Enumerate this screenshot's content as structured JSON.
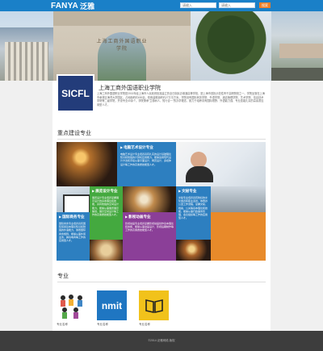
{
  "header": {
    "logo_en": "FANYA",
    "logo_cn": "泛雅",
    "search1_placeholder": "请输入",
    "search2_placeholder": "请输入",
    "search_button": "搜索"
  },
  "banner": {
    "gate_text": "上海工商外国语职业学院"
  },
  "intro": {
    "logo_text": "SICFL",
    "title": "上海工商外国语职业学院",
    "text": "上海工商外国语职业学院是2002年经上海市人民政府批准建立的全日制民办普通高等学校，是上海市首批示范性骨干高职院校之一。学院坐落在上海市奉贤区海湾大学园区，占地面积约630亩，校舍建筑面积约27万平方米。学院设有国际商务学院、外语学院、酒店管理学院、艺术学院、信息技术学院等二级学院，开设专业40余个。学院秉承“立德树人、知行合一”的办学理念，致力于培养具有国际视野、外语能力强、专业技能扎实的高素质应用型人才。"
  },
  "sections": {
    "featured": "重点建设专业",
    "majors": "专业"
  },
  "tiles": [
    {
      "title": "电脑艺术设计专业",
      "text": "电脑艺术设计专业培养具有扎实的设计基础理论知识和较强的计算机应用能力，能够运用现代设计方法和手段从事平面设计、网页设计、多媒体设计等工作的高素质技能型人才。"
    },
    {
      "title": "文秘专业",
      "text": "文秘专业培养具有较好的文化素养和职业道德，熟悉办公室工作流程，掌握文秘、档案、公关等基本理论和技能，能够从事行政事务管理、会议组织等工作的应用型人才。"
    },
    {
      "title": "展览设计专业",
      "text": "展览设计专业培养掌握展示设计的基本理论和技能，具有较强的空间设计能力，能够从事展览展示策划、展示空间设计等工作的高素质技能型人才。"
    },
    {
      "title": "国际商务专业",
      "text": "国际商务专业培养具有国际贸易基本理论知识和较强的外语能力，熟悉国际商务规则，能够从事外贸业务、跨境电商等工作的应用型人才。"
    },
    {
      "title": "影视动画专业",
      "text": "影视动画专业培养掌握影视动画创作基本理论和技能，能够从事动画设计、影视后期制作等工作的高素质技能型人才。"
    }
  ],
  "majors": [
    {
      "label": "专业名称"
    },
    {
      "label": "专业名称"
    },
    {
      "label": "专业名称"
    }
  ],
  "thumbs": {
    "nmit": "nmit"
  },
  "footer": {
    "text": "©2014 泛雅网络 版权"
  },
  "colors": {
    "header_blue": "#1a80c8",
    "tile_blue": "#2d7fc0",
    "tile_green": "#44a93f",
    "tile_purple": "#8b3f98",
    "tile_orange": "#e88a2a",
    "thumb_blue": "#1f76c2",
    "thumb_yellow": "#f1c21b"
  }
}
